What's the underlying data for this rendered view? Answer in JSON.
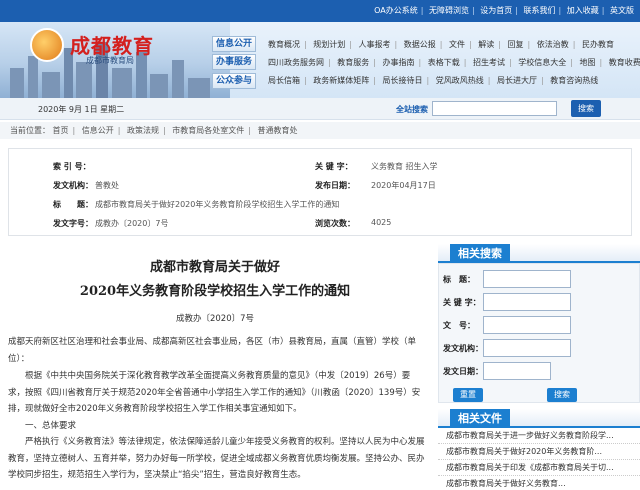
{
  "top_links": [
    "OA办公系统",
    "无障碍浏览",
    "设为首页",
    "联系我们",
    "加入收藏",
    "英文版"
  ],
  "header": {
    "site_title": "成都教育",
    "site_subtitle": "成都市教育局",
    "nav_buttons": [
      "信息公开",
      "办事服务",
      "公众参与"
    ],
    "nav_rows": [
      [
        "教育概况",
        "规划计划",
        "人事报考",
        "数据公报",
        "文件",
        "解读",
        "回复",
        "依法治教",
        "民办教育"
      ],
      [
        "四川政务服务网",
        "教育服务",
        "办事指南",
        "表格下载",
        "招生考试",
        "学校信息大全",
        "地图",
        "教育收费"
      ],
      [
        "局长信箱",
        "政务新媒体矩阵",
        "局长接待日",
        "党风政风热线",
        "局长进大厅",
        "教育咨询热线"
      ]
    ]
  },
  "datebar": {
    "date": "2020年 9月 1日 星期二",
    "search_label": "全站搜索",
    "search_placeholder": "",
    "search_button": "搜索"
  },
  "breadcrumb": {
    "prefix": "当前位置：",
    "items": [
      "首页",
      "信息公开",
      "政策法规",
      "市教育局各处室文件",
      "普通教育处"
    ]
  },
  "info": {
    "index_label": "索 引 号：",
    "index_value": "",
    "keyword_label": "关 键 字：",
    "keyword_value": "义务教育 招生入学",
    "issuer_label": "发文机构：",
    "issuer_value": "普教处",
    "date_label": "发布日期：",
    "date_value": "2020年04月17日",
    "title_label": "标　　题：",
    "title_value": "成都市教育局关于做好2020年义务教育阶段学校招生入学工作的通知",
    "docno_label": "发文字号：",
    "docno_value": "成教办〔2020〕7号",
    "views_label": "浏览次数：",
    "views_value": "4025"
  },
  "article": {
    "title_line1": "成都市教育局关于做好",
    "title_line2": "2020年义务教育阶段学校招生入学工作的通知",
    "doc_no": "成教办〔2020〕7号",
    "para1": "成都天府新区社区治理和社会事业局、成都高新区社会事业局，各区（市）县教育局，直属（直管）学校（单位）：",
    "para2": "根据《中共中央国务院关于深化教育教学改革全面提高义务教育质量的意见》（中发〔2019〕26号）要求，按照《四川省教育厅关于规范2020年全省普通中小学招生入学工作的通知》（川教函〔2020〕139号）安排，现就做好全市2020年义务教育阶段学校招生入学工作相关事宜通知如下。",
    "heading1": "一、总体要求",
    "para3": "严格执行《义务教育法》等法律规定，依法保障适龄儿童少年接受义务教育的权利。坚持以人民为中心发展教育，坚持立德树人、五育并举，努力办好每一所学校，促进全域成都义务教育优质均衡发展。坚持公办、民办学校同步招生，规范招生入学行为，坚决禁止“掐尖”招生，营造良好教育生态。"
  },
  "sidebar": {
    "search_title": "相关搜索",
    "fields": [
      "标　题：",
      "关 键 字：",
      "文　号：",
      "发文机构：",
      "发文日期："
    ],
    "reset_button": "重置",
    "search_button": "搜索",
    "related_title": "相关文件",
    "related_items": [
      "成都市教育局关于进一步做好义务教育阶段学...",
      "成都市教育局关于做好2020年义务教育阶...",
      "成都市教育局关于印发《成都市教育局关于切...",
      "成都市教育局关于做好义务教育..."
    ]
  }
}
